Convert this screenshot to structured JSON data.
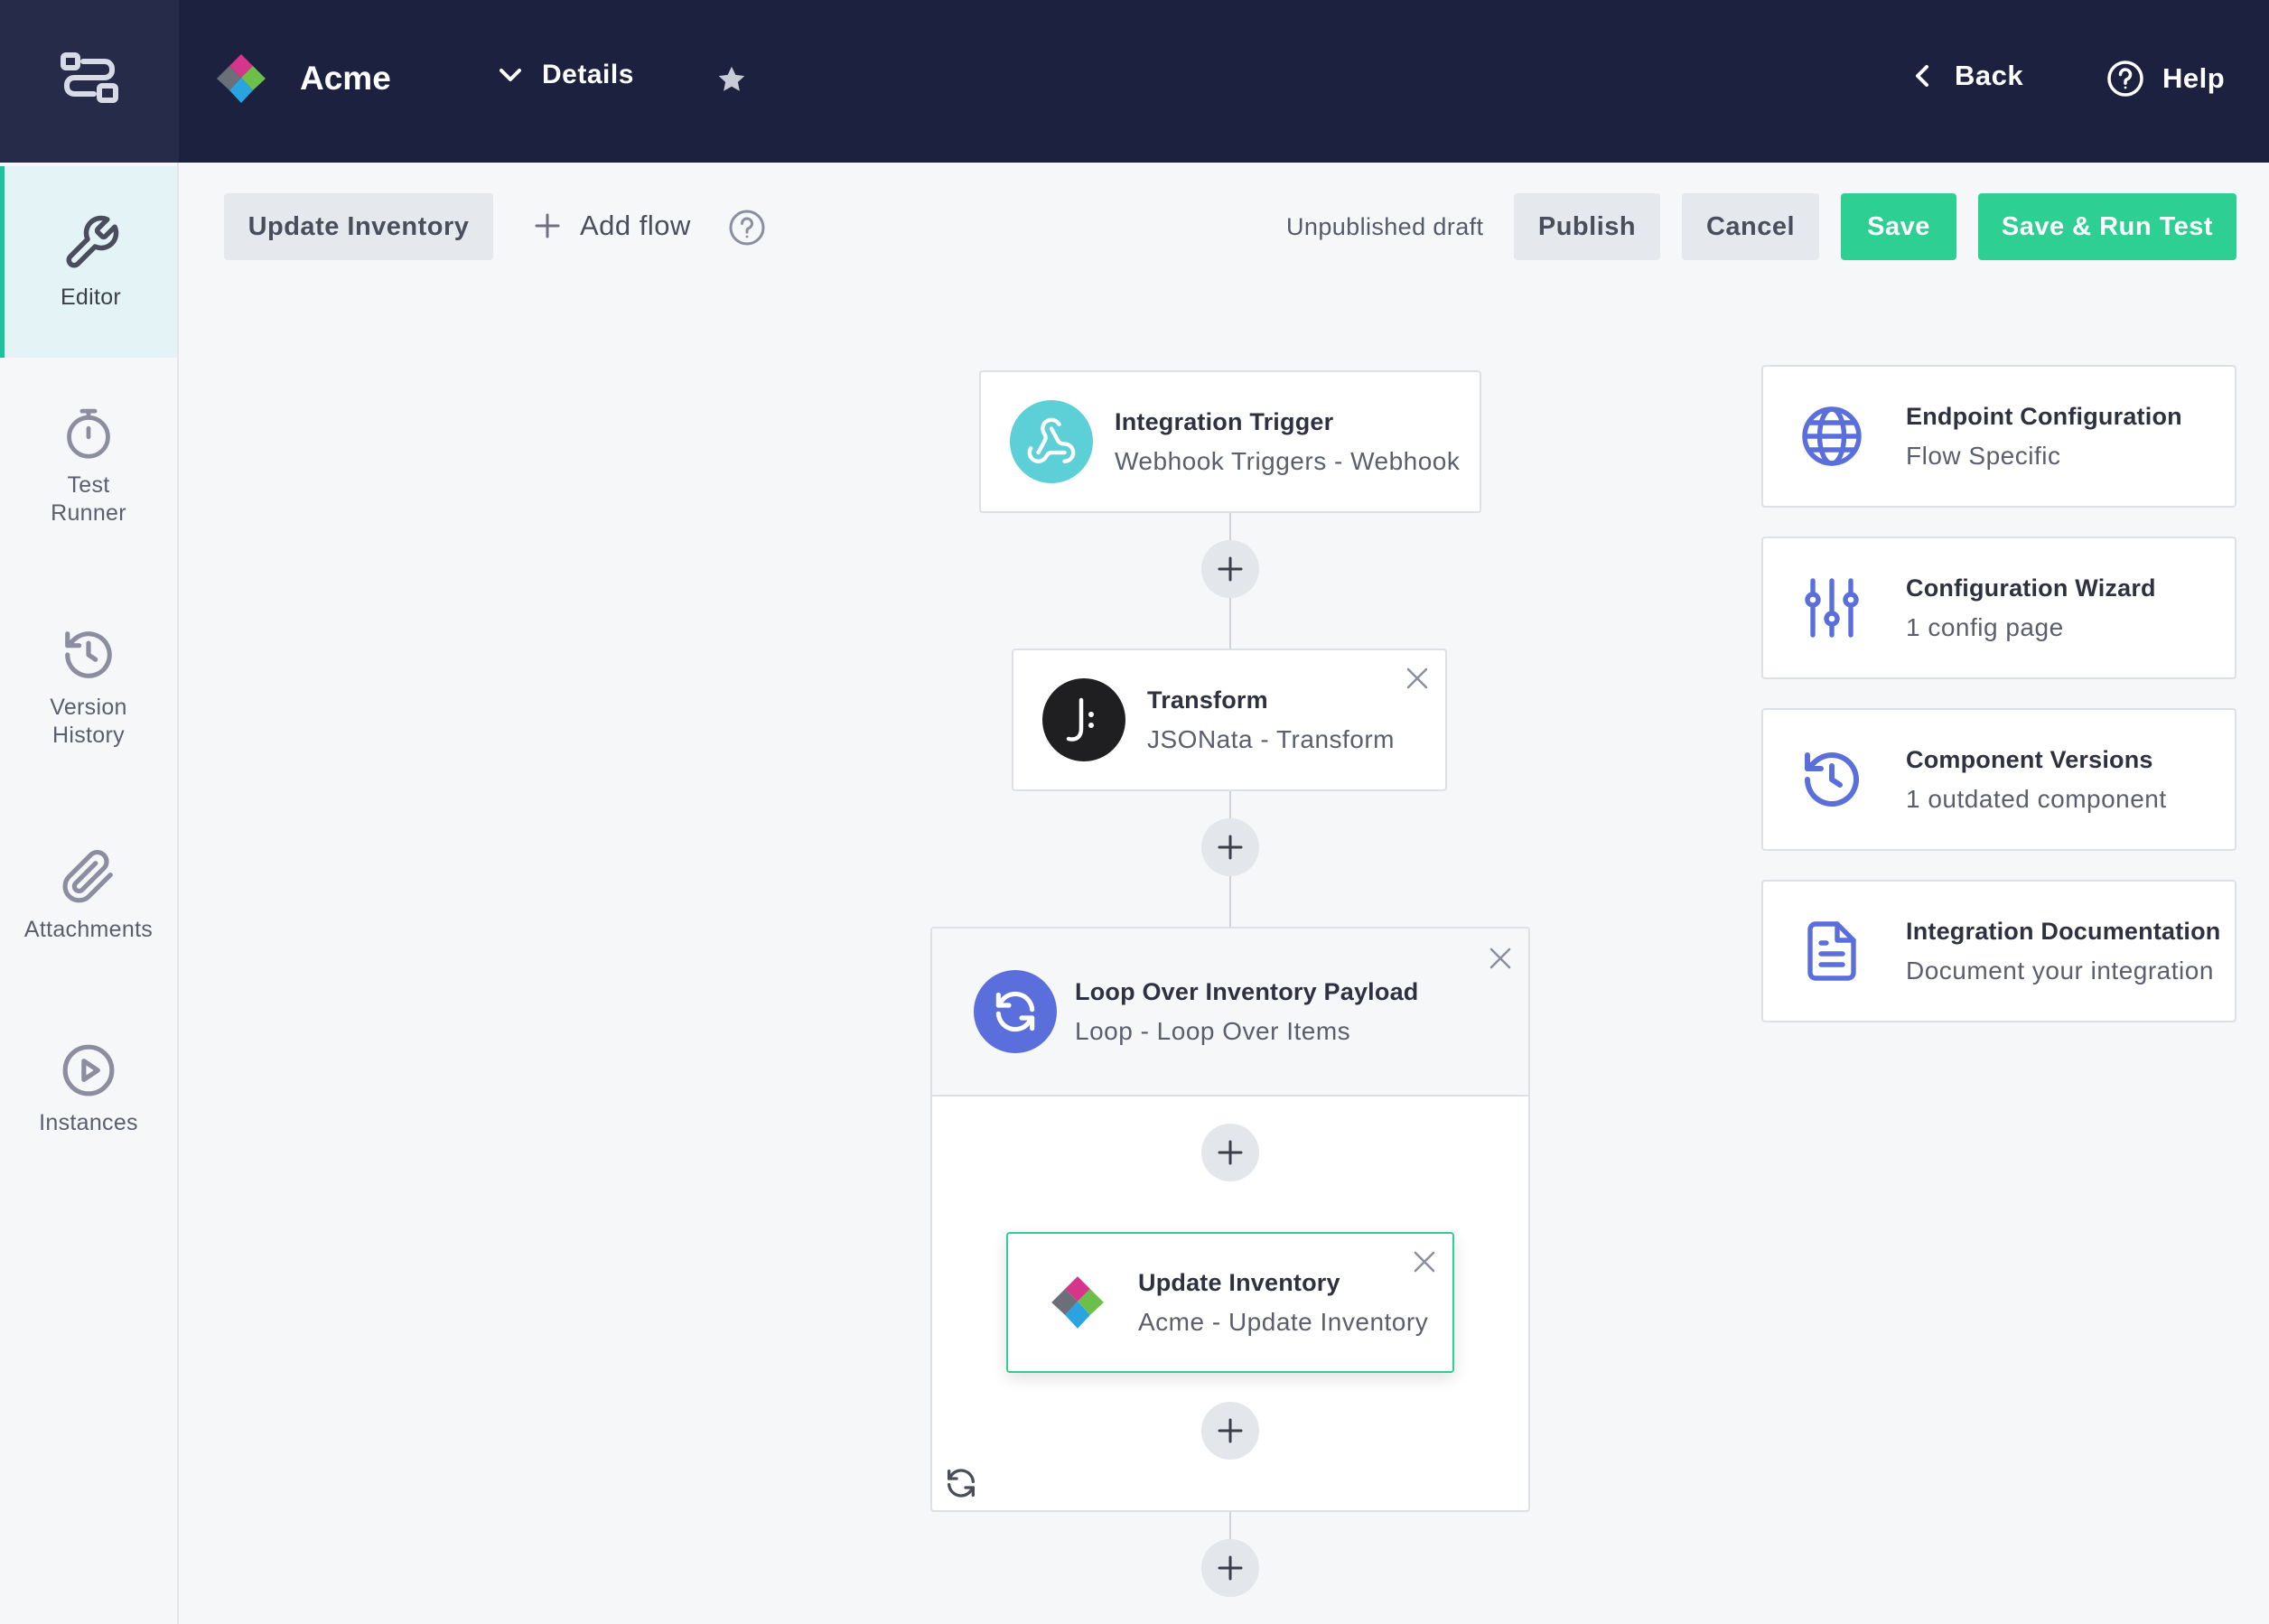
{
  "header": {
    "brand_name": "Acme",
    "details_label": "Details",
    "back_label": "Back",
    "help_label": "Help"
  },
  "sidebar": {
    "items": [
      {
        "label": "Editor",
        "icon": "wrench-icon",
        "active": true
      },
      {
        "label": "Test\nRunner",
        "icon": "stopwatch-icon",
        "active": false
      },
      {
        "label": "Version\nHistory",
        "icon": "history-icon",
        "active": false
      },
      {
        "label": "Attachments",
        "icon": "paperclip-icon",
        "active": false
      },
      {
        "label": "Instances",
        "icon": "play-circle-icon",
        "active": false
      }
    ]
  },
  "toolbar": {
    "flow_tab_label": "Update Inventory",
    "add_flow_label": "Add flow",
    "status_text": "Unpublished draft",
    "publish_label": "Publish",
    "cancel_label": "Cancel",
    "save_label": "Save",
    "save_run_label": "Save & Run Test"
  },
  "flow": {
    "trigger": {
      "title": "Integration Trigger",
      "subtitle": "Webhook Triggers - Webhook",
      "icon": "webhook-icon"
    },
    "transform": {
      "title": "Transform",
      "subtitle": "JSONata - Transform",
      "icon": "jsonata-icon"
    },
    "loop": {
      "title": "Loop Over Inventory Payload",
      "subtitle": "Loop - Loop Over Items",
      "icon": "loop-icon"
    },
    "update": {
      "title": "Update Inventory",
      "subtitle": "Acme - Update Inventory",
      "icon": "acme-logo-icon"
    }
  },
  "panels": [
    {
      "title": "Endpoint Configuration",
      "subtitle": "Flow Specific",
      "icon": "globe-icon"
    },
    {
      "title": "Configuration Wizard",
      "subtitle": "1 config page",
      "icon": "sliders-icon"
    },
    {
      "title": "Component Versions",
      "subtitle": "1 outdated component",
      "icon": "history-icon"
    },
    {
      "title": "Integration Documentation",
      "subtitle": "Document your integration",
      "icon": "document-icon"
    }
  ],
  "colors": {
    "topbar": "#1c2140",
    "accent_green": "#2ecf93",
    "trigger_teal": "#5dcfd6",
    "loop_blue": "#5a6fdc",
    "panel_icon_blue": "#5a6fdc"
  }
}
